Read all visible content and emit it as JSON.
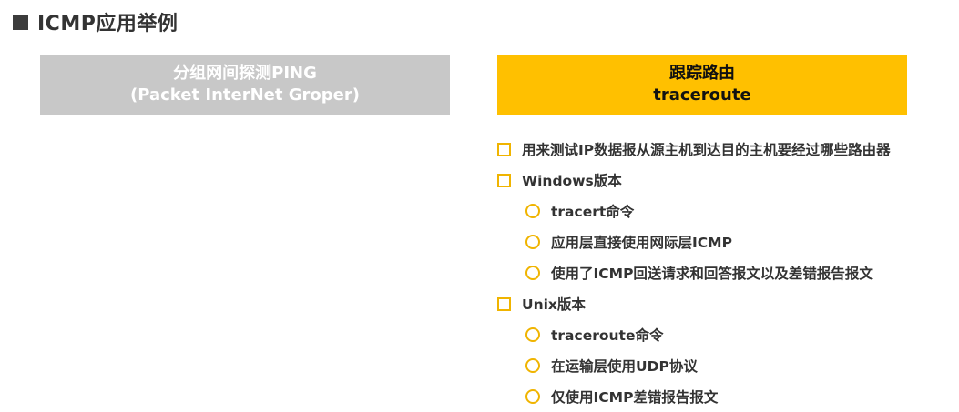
{
  "title": "ICMP应用举例",
  "ping": {
    "line1": "分组网间探测PING",
    "line2": "(Packet InterNet Groper)"
  },
  "traceroute": {
    "line1": "跟踪路由",
    "line2": "traceroute"
  },
  "items": [
    {
      "level": 1,
      "text": "用来测试IP数据报从源主机到达目的主机要经过哪些路由器"
    },
    {
      "level": 1,
      "text": "Windows版本"
    },
    {
      "level": 2,
      "text": "tracert命令"
    },
    {
      "level": 2,
      "text": "应用层直接使用网际层ICMP"
    },
    {
      "level": 2,
      "text": "使用了ICMP回送请求和回答报文以及差错报告报文"
    },
    {
      "level": 1,
      "text": "Unix版本"
    },
    {
      "level": 2,
      "text": "traceroute命令"
    },
    {
      "level": 2,
      "text": "在运输层使用UDP协议"
    },
    {
      "level": 2,
      "text": "仅使用ICMP差错报告报文"
    }
  ],
  "colors": {
    "accent": "#ffc000",
    "bullet": "#f0b400",
    "ping_box": "#c8c8c8",
    "title_square": "#3c3c3c"
  }
}
